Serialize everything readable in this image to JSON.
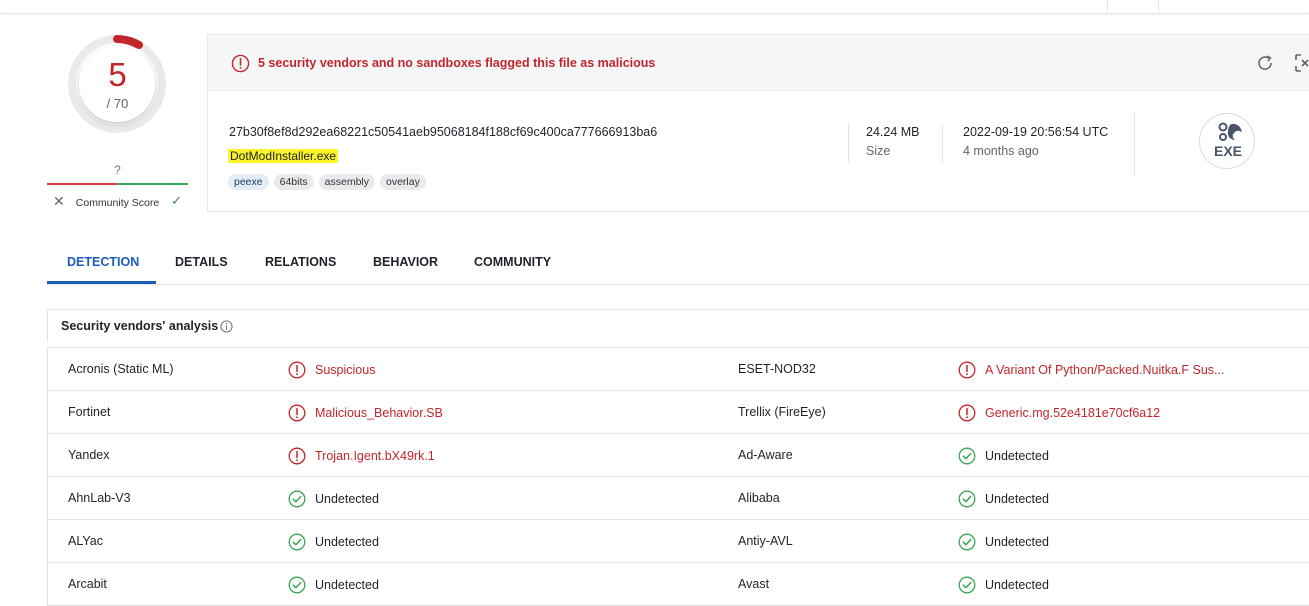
{
  "score": {
    "detections": "5",
    "total": "/ 70",
    "community_value": "?",
    "community_label": "Community Score"
  },
  "alert": {
    "text": "5 security vendors and no sandboxes flagged this file as malicious"
  },
  "file": {
    "hash": "27b30f8ef8d292ea68221c50541aeb95068184f188cf69c400ca777666913ba6",
    "name": "DotModInstaller.exe",
    "tags": [
      "peexe",
      "64bits",
      "assembly",
      "overlay"
    ],
    "size_value": "24.24 MB",
    "size_label": "Size",
    "date_value": "2022-09-19 20:56:54 UTC",
    "date_ago": "4 months ago",
    "type_badge": "EXE"
  },
  "tabs": [
    "DETECTION",
    "DETAILS",
    "RELATIONS",
    "BEHAVIOR",
    "COMMUNITY"
  ],
  "section": {
    "title": "Security vendors' analysis"
  },
  "vendors": [
    [
      {
        "name": "Acronis (Static ML)",
        "result": "Suspicious",
        "status": "bad"
      },
      {
        "name": "ESET-NOD32",
        "result": "A Variant Of Python/Packed.Nuitka.F Sus...",
        "status": "bad"
      }
    ],
    [
      {
        "name": "Fortinet",
        "result": "Malicious_Behavior.SB",
        "status": "bad"
      },
      {
        "name": "Trellix (FireEye)",
        "result": "Generic.mg.52e4181e70cf6a12",
        "status": "bad"
      }
    ],
    [
      {
        "name": "Yandex",
        "result": "Trojan.Igent.bX49rk.1",
        "status": "bad"
      },
      {
        "name": "Ad-Aware",
        "result": "Undetected",
        "status": "good"
      }
    ],
    [
      {
        "name": "AhnLab-V3",
        "result": "Undetected",
        "status": "good"
      },
      {
        "name": "Alibaba",
        "result": "Undetected",
        "status": "good"
      }
    ],
    [
      {
        "name": "ALYac",
        "result": "Undetected",
        "status": "good"
      },
      {
        "name": "Antiy-AVL",
        "result": "Undetected",
        "status": "good"
      }
    ],
    [
      {
        "name": "Arcabit",
        "result": "Undetected",
        "status": "good"
      },
      {
        "name": "Avast",
        "result": "Undetected",
        "status": "good"
      }
    ]
  ],
  "colors": {
    "malicious": "#c2262b",
    "clean": "#3aa655",
    "accent": "#1a5dbb"
  }
}
